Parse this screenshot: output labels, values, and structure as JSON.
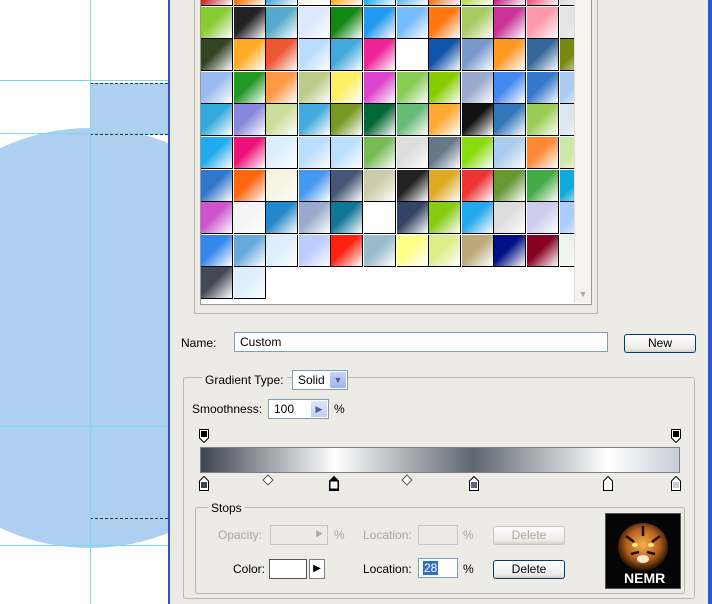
{
  "preset_grid": {
    "columns": 12,
    "rows": [
      [
        "#cc2222",
        "#f07000",
        "#44a8d8",
        "#f4f6ea",
        "#ffb020",
        "#22aaee",
        "#66bbee",
        "#ee7722",
        "#bbdd55",
        "#cc2288",
        "#ee5577",
        "#dddddd"
      ],
      [
        "#88cc33",
        "#222222",
        "#55aacc",
        "#dde8ff",
        "#118811",
        "#2299ee",
        "#77bbff",
        "#ff7711",
        "#aacc66",
        "#cc3399",
        "#ff99aa",
        "#e4e4e4"
      ],
      [
        "#334422",
        "#ffaa22",
        "#ee5533",
        "#bbddff",
        "#44aadd",
        "#ee2299",
        "#ffffff",
        "#1155aa",
        "#7799cc",
        "#ff9922",
        "#336699",
        "#778811"
      ],
      [
        "#99bbee",
        "#229922",
        "#ff9944",
        "#bbcc88",
        "#ffee66",
        "#dd44cc",
        "#88cc55",
        "#88cc00",
        "#99aacc",
        "#4488ee",
        "#3377cc",
        "#aaccee"
      ],
      [
        "#33aadd",
        "#8888dd",
        "#ccdd99",
        "#44aadd",
        "#779922",
        "#006633",
        "#66bb77",
        "#ffaa33",
        "#111111",
        "#3377bb",
        "#99cc55",
        "#dde6f0"
      ],
      [
        "#22aaee",
        "#ee1177",
        "#ddeeff",
        "#bbddff",
        "#bbe0ff",
        "#77bb55",
        "#dddddd",
        "#667788",
        "#88dd11",
        "#aaccee",
        "#ff8833",
        "#cce8aa"
      ],
      [
        "#3377cc",
        "#ff6611",
        "#f4f4e0",
        "#4499ee",
        "#445577",
        "#ccccaa",
        "#222222",
        "#ddaa22",
        "#ee3333",
        "#669933",
        "#44aa44",
        "#11aadd"
      ],
      [
        "#cc55cc",
        "#f4f4f4",
        "#2288cc",
        "#99aacc",
        "#117799",
        "#ffffff",
        "#334466",
        "#88cc11",
        "#22aaee",
        "#dddddd",
        "#ccccee",
        "#aaccff"
      ],
      [
        "#3388ee",
        "#66aadd",
        "#ddeeff",
        "#bbccff",
        "#ff2211",
        "#99bbcc",
        "#ffff88",
        "#ddee88",
        "#bbaa77",
        "#001188",
        "#880022",
        "#eef4ee"
      ],
      [
        "#444a55",
        "#ddeeff"
      ]
    ]
  },
  "name": {
    "label": "Name:",
    "value": "Custom"
  },
  "new_button": "New",
  "gradient_type": {
    "label": "Gradient Type:",
    "value": "Solid"
  },
  "smoothness": {
    "label": "Smoothness:",
    "value": "100",
    "unit": "%"
  },
  "gradient": {
    "stops": [
      {
        "location": 0,
        "color": "#3c4450"
      },
      {
        "location": 28,
        "color": "#ffffff"
      },
      {
        "location": 57,
        "color": "#5d6670"
      },
      {
        "location": 85,
        "color": "#ffffff"
      },
      {
        "location": 100,
        "color": "#c8ced8"
      }
    ],
    "opacity_stops": [
      0,
      100
    ],
    "midpoints": [
      14,
      43
    ],
    "selected_stop": 1
  },
  "stops": {
    "title": "Stops",
    "opacity_label": "Opacity:",
    "opacity_unit": "%",
    "opacity_location_label": "Location:",
    "opacity_location_unit": "%",
    "opacity_delete": "Delete",
    "color_label": "Color:",
    "color_value": "#ffffff",
    "color_location_label": "Location:",
    "color_location_value": "28",
    "color_location_unit": "%",
    "color_delete": "Delete"
  },
  "logo_text": "NEMR"
}
